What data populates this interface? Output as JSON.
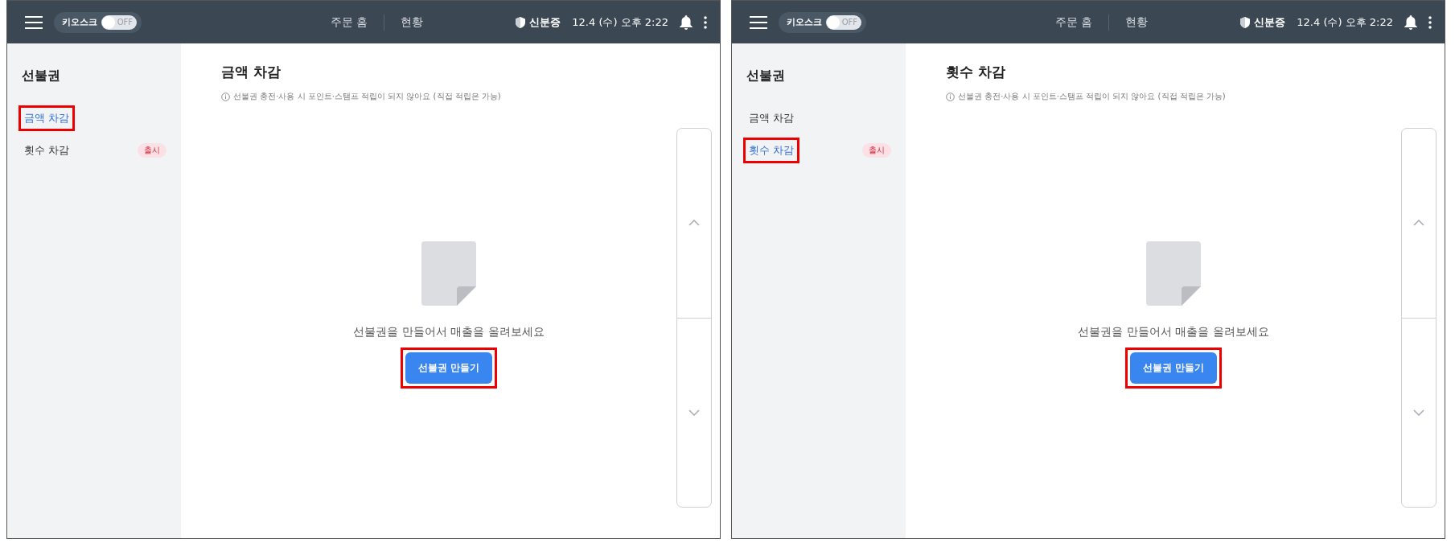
{
  "panels": [
    {
      "topbar": {
        "kiosk_label": "키오스크",
        "kiosk_toggle": {
          "on": false,
          "label": "OFF"
        },
        "nav": [
          "주문 홈",
          "현황"
        ],
        "id_label": "신분증",
        "datetime": "12.4 (수) 오후 2:22"
      },
      "sidebar": {
        "title": "선불권",
        "items": [
          {
            "label": "금액 차감",
            "selected": true,
            "highlighted": true
          },
          {
            "label": "횟수 차감",
            "selected": false,
            "highlighted": false,
            "badge": "출시"
          }
        ]
      },
      "content": {
        "title": "금액 차감",
        "notice": "선불권 충전·사용 시 포인트·스탬프 적립이 되지 않아요 (직접 적립은 가능)",
        "empty_message": "선불권을 만들어서 매출을 올려보세요",
        "button": {
          "label": "선불권 만들기",
          "highlighted": true
        }
      }
    },
    {
      "topbar": {
        "kiosk_label": "키오스크",
        "kiosk_toggle": {
          "on": false,
          "label": "OFF"
        },
        "nav": [
          "주문 홈",
          "현황"
        ],
        "id_label": "신분증",
        "datetime": "12.4 (수) 오후 2:22"
      },
      "sidebar": {
        "title": "선불권",
        "items": [
          {
            "label": "금액 차감",
            "selected": false,
            "highlighted": false
          },
          {
            "label": "횟수 차감",
            "selected": true,
            "highlighted": true,
            "badge": "출시"
          }
        ]
      },
      "content": {
        "title": "횟수 차감",
        "notice": "선불권 충전·사용 시 포인트·스탬프 적립이 되지 않아요 (직접 적립은 가능)",
        "empty_message": "선불권을 만들어서 매출을 올려보세요",
        "button": {
          "label": "선불권 만들기",
          "highlighted": true
        }
      }
    }
  ]
}
